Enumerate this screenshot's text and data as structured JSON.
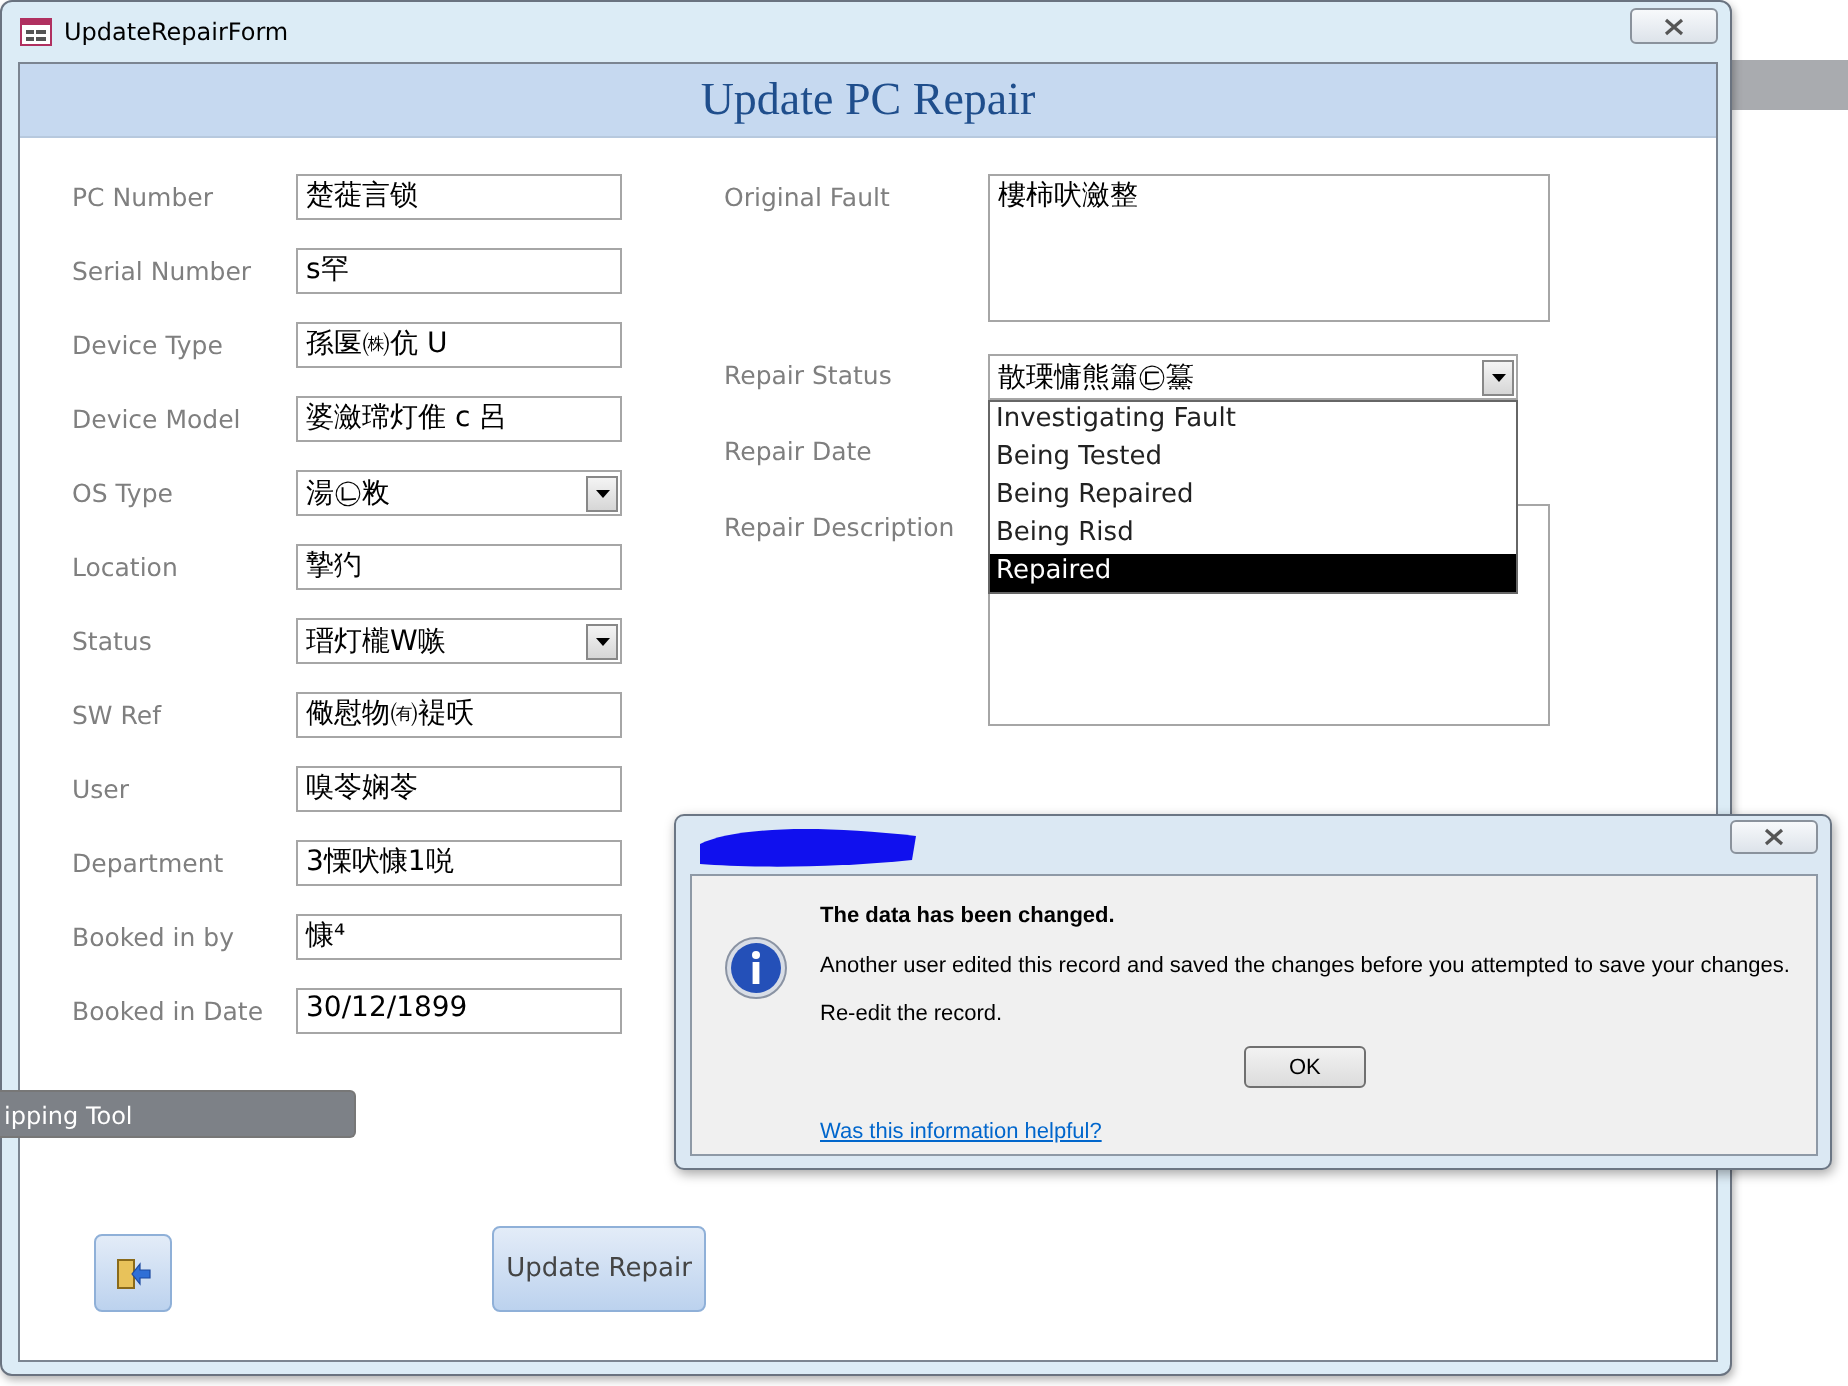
{
  "window": {
    "title": "UpdateRepairForm"
  },
  "header": {
    "title": "Update PC Repair"
  },
  "left_fields": [
    {
      "label": "PC Number",
      "value": "楚蓰言锁",
      "kind": "text"
    },
    {
      "label": "Serial Number",
      "value": "s罕",
      "kind": "text"
    },
    {
      "label": "Device Type",
      "value": "孫匽㈱伉 U",
      "kind": "text"
    },
    {
      "label": "Device Model",
      "value": "婆瀲瑺灯倠 c 呂",
      "kind": "text"
    },
    {
      "label": "OS Type",
      "value": "湯㉡敉",
      "kind": "combo"
    },
    {
      "label": "Location",
      "value": "摯犳",
      "kind": "text"
    },
    {
      "label": "Status",
      "value": "瑨灯櫳W嗾",
      "kind": "combo"
    },
    {
      "label": "SW Ref",
      "value": "儆慰物㈲褆㕭",
      "kind": "text"
    },
    {
      "label": "User",
      "value": "嗅苓娴苓",
      "kind": "text"
    },
    {
      "label": "Department",
      "value": "3慄吠慷1哾",
      "kind": "text"
    },
    {
      "label": "Booked in by",
      "value": "慷⁴",
      "kind": "text"
    },
    {
      "label": "Booked in Date",
      "value": "30/12/1899",
      "kind": "text"
    }
  ],
  "right_fields": [
    {
      "label": "Original Fault",
      "value": "樓柿吠瀲整",
      "kind": "memo"
    },
    {
      "label": "Repair Status",
      "value": "散瑮慵熊簫㉢䵵",
      "kind": "combo"
    },
    {
      "label": "Repair Date",
      "kind": "covered"
    },
    {
      "label": "Repair Description",
      "kind": "memo"
    }
  ],
  "dropdown": {
    "options": [
      {
        "label": "Investigating Fault",
        "selected": false
      },
      {
        "label": "Being Tested",
        "selected": false
      },
      {
        "label": "Being Repaired",
        "selected": false
      },
      {
        "label": "Being Risd",
        "selected": false
      },
      {
        "label": "Repaired",
        "selected": true
      }
    ]
  },
  "buttons": [
    {
      "kind": "icon"
    },
    {
      "kind": "text",
      "label": "Update Repair"
    }
  ],
  "tooltip": {
    "text": "ipping Tool"
  },
  "dialog": {
    "heading": "The data has been changed.",
    "message": "Another user edited this record and saved the changes before you attempted to save your changes.",
    "note": "Re-edit the record.",
    "button": "OK",
    "link": "Was this information helpful?"
  }
}
